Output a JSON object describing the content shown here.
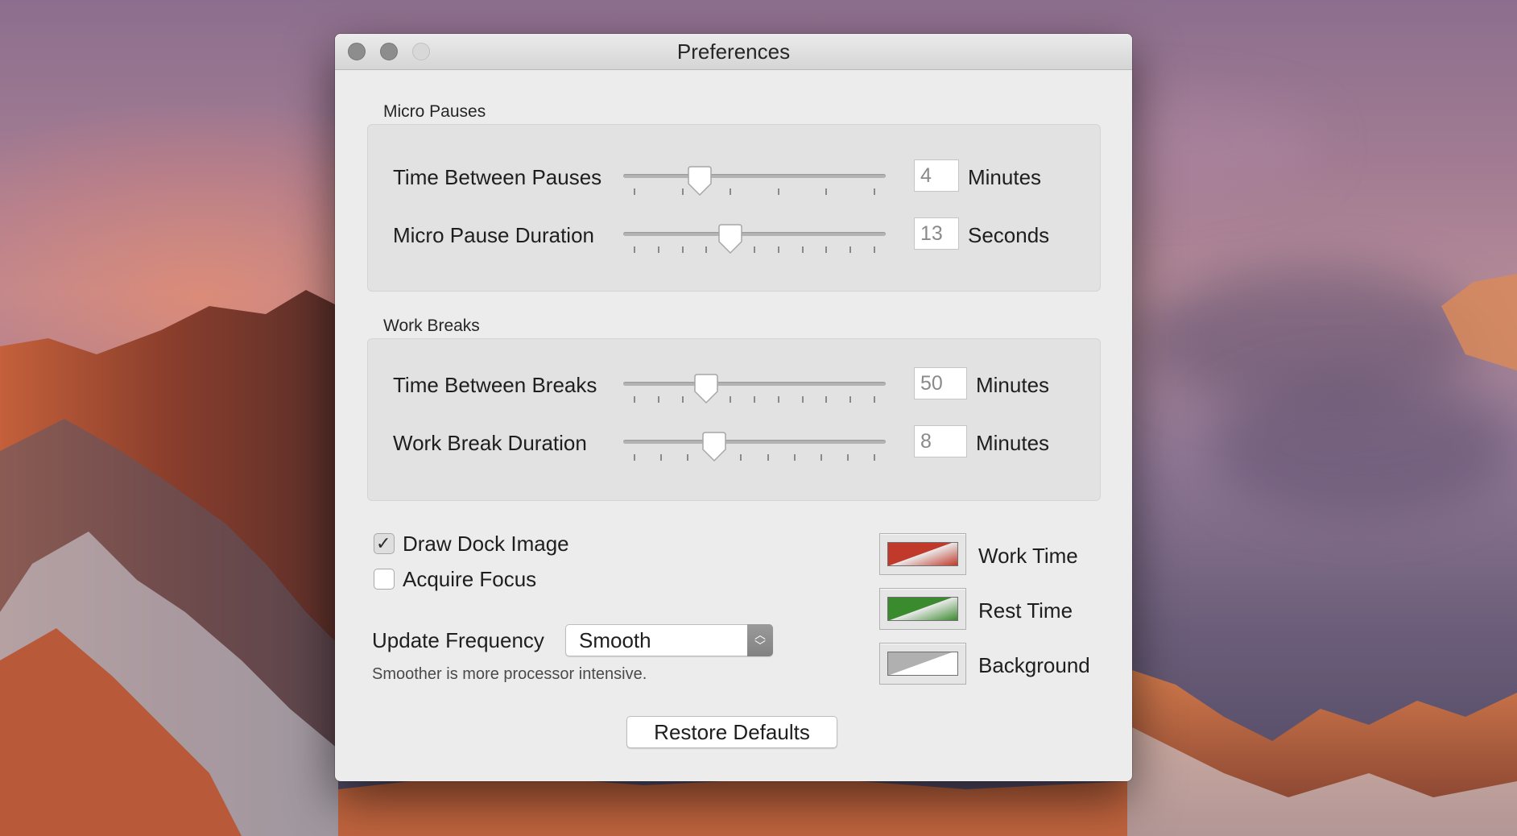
{
  "window": {
    "title": "Preferences",
    "controls": [
      "close",
      "minimize",
      "zoom"
    ]
  },
  "micro_pauses": {
    "group_label": "Micro Pauses",
    "rows": [
      {
        "label": "Time Between Pauses",
        "value": "4",
        "unit": "Minutes",
        "slider": {
          "min": 1,
          "max": 12,
          "value": 4,
          "tick_count": 6
        }
      },
      {
        "label": "Micro Pause Duration",
        "value": "13",
        "unit": "Seconds",
        "slider": {
          "min": 5,
          "max": 25,
          "value": 13,
          "tick_count": 11
        }
      }
    ]
  },
  "work_breaks": {
    "group_label": "Work Breaks",
    "rows": [
      {
        "label": "Time Between Breaks",
        "value": "50",
        "unit": "Minutes",
        "slider": {
          "min": 20,
          "max": 120,
          "value": 50,
          "tick_count": 11
        }
      },
      {
        "label": "Work Break Duration",
        "value": "8",
        "unit": "Minutes",
        "slider": {
          "min": 2,
          "max": 20,
          "value": 8,
          "tick_count": 10
        }
      }
    ]
  },
  "options": {
    "draw_dock_image": {
      "label": "Draw Dock Image",
      "checked": true
    },
    "acquire_focus": {
      "label": "Acquire Focus",
      "checked": false
    }
  },
  "update_frequency": {
    "label": "Update Frequency",
    "selected": "Smooth",
    "hint": "Smoother is more processor intensive."
  },
  "colors": [
    {
      "label": "Work Time",
      "color": "#c0392b",
      "icon": "red-swatch"
    },
    {
      "label": "Rest Time",
      "color": "#3a8a2e",
      "icon": "green-swatch"
    },
    {
      "label": "Background",
      "color": "#b0b0b0",
      "icon": "gray-swatch"
    }
  ],
  "restore_defaults_label": "Restore Defaults",
  "theme": {
    "window_bg": "#ececec",
    "group_bg": "#e2e2e2",
    "desktop_sky": "#9a7a95"
  }
}
